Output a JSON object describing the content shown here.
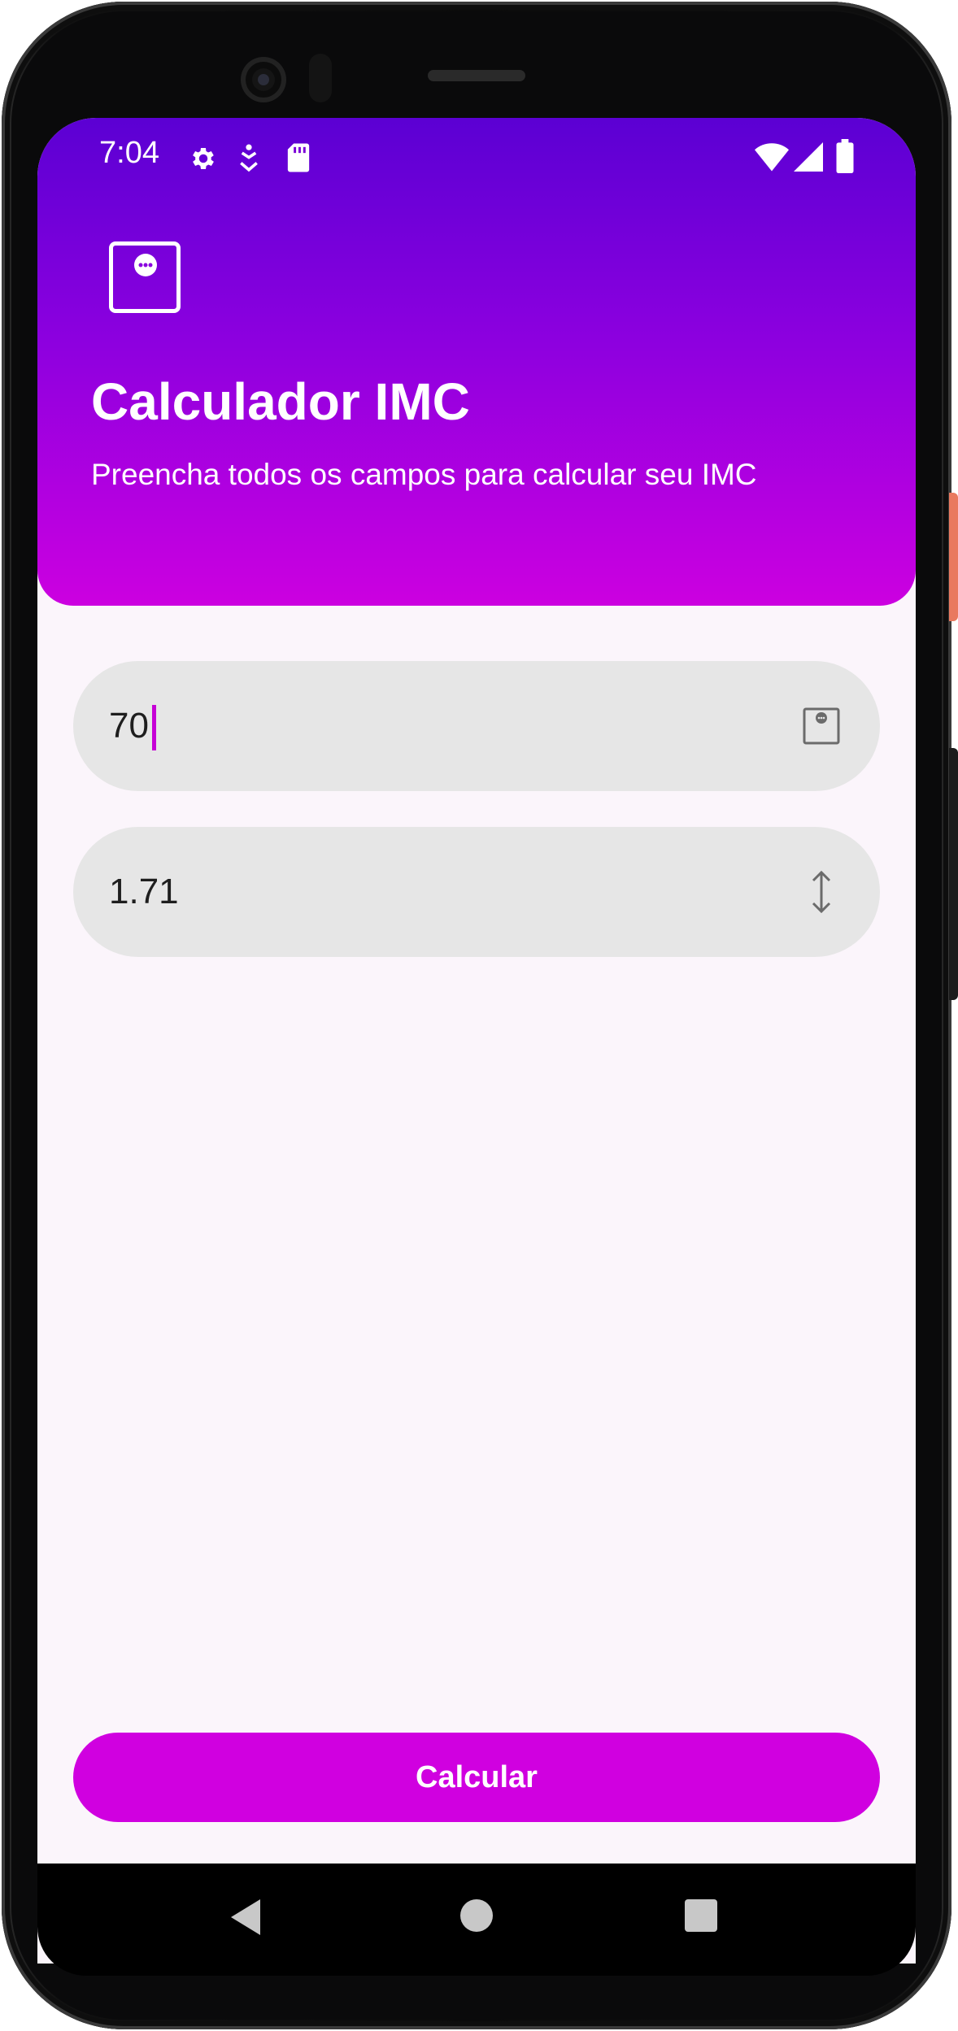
{
  "status_bar": {
    "time": "7:04",
    "left_icons": [
      "gear-icon",
      "accessibility-download-icon",
      "sd-card-icon"
    ],
    "right_icons": [
      "wifi-icon",
      "signal-icon",
      "battery-icon"
    ]
  },
  "header": {
    "title": "Calculador IMC",
    "subtitle": "Preencha todos os campos para calcular seu IMC",
    "logo_icon": "scale-icon",
    "gradient_top": "#5b00d3",
    "gradient_bottom": "#cc00e0"
  },
  "form": {
    "weight": {
      "value": "70",
      "icon": "scale-icon",
      "focused": true
    },
    "height": {
      "value": "1.71",
      "icon": "height-arrows-icon"
    }
  },
  "actions": {
    "calculate_label": "Calcular",
    "accent": "#d000e0"
  },
  "navigation": {
    "buttons": [
      "back-icon",
      "home-icon",
      "recents-icon"
    ]
  }
}
